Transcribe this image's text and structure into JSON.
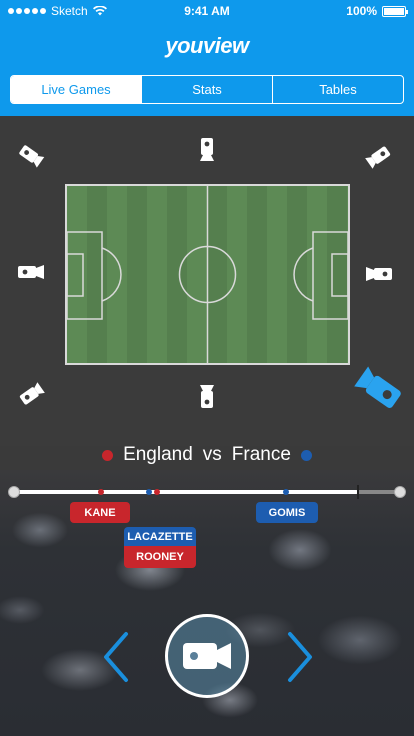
{
  "status_bar": {
    "carrier": "Sketch",
    "time": "9:41 AM",
    "battery": "100%",
    "battery_level": 1.0
  },
  "brand": {
    "name": "youview"
  },
  "tabs": [
    {
      "label": "Live Games",
      "active": true
    },
    {
      "label": "Stats",
      "active": false
    },
    {
      "label": "Tables",
      "active": false
    }
  ],
  "cameras": [
    {
      "name": "top-left",
      "selected": false
    },
    {
      "name": "top-center",
      "selected": false
    },
    {
      "name": "top-right",
      "selected": false
    },
    {
      "name": "middle-left",
      "selected": false
    },
    {
      "name": "middle-right",
      "selected": false
    },
    {
      "name": "bottom-left",
      "selected": false
    },
    {
      "name": "bottom-center",
      "selected": false
    },
    {
      "name": "bottom-right",
      "selected": true
    }
  ],
  "match": {
    "home": "England",
    "vs": "vs",
    "away": "France",
    "home_color": "#c8262c",
    "away_color": "#1d5db0"
  },
  "timeline": {
    "progress": 0.89,
    "events": [
      {
        "player": "KANE",
        "team": "home",
        "position": 0.225
      },
      {
        "player": "LACAZETTE",
        "team": "away",
        "position": 0.35
      },
      {
        "player": "ROONEY",
        "team": "home",
        "position": 0.37
      },
      {
        "player": "GOMIS",
        "team": "away",
        "position": 0.705
      }
    ]
  },
  "colors": {
    "accent": "#0e99ec",
    "background": "#3a3a3a"
  },
  "icons": {
    "record": "video-camera-icon",
    "prev": "chevron-left-icon",
    "next": "chevron-right-icon"
  }
}
